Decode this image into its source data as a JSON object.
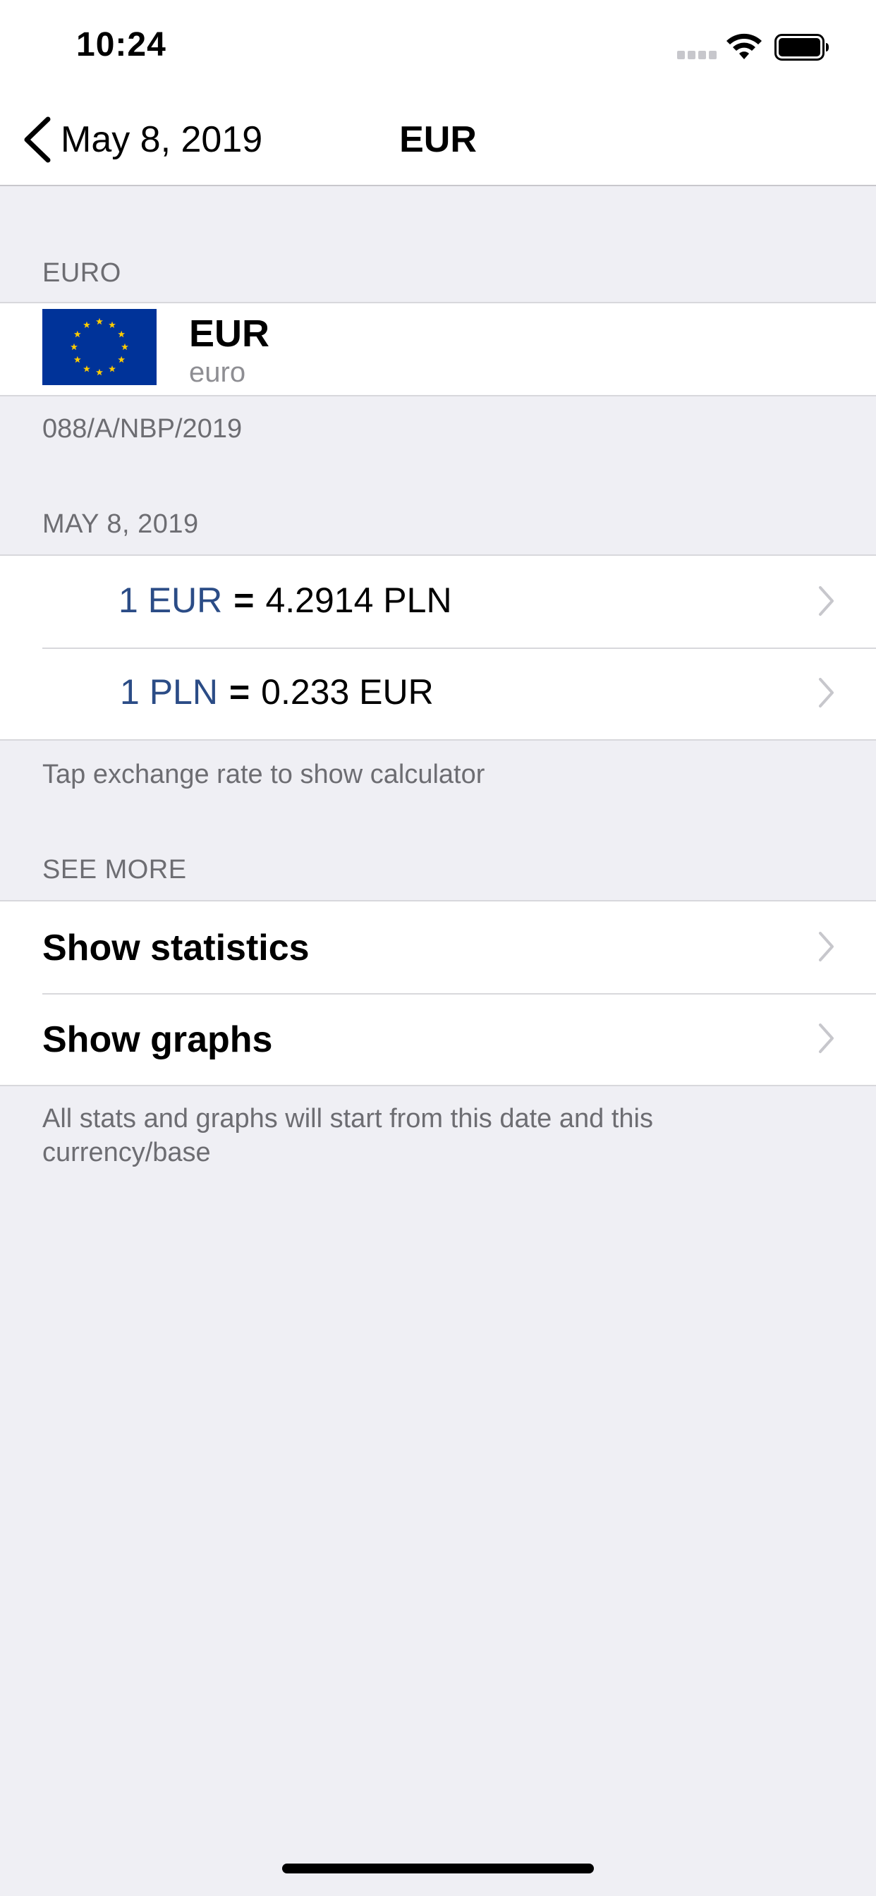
{
  "status_bar": {
    "time": "10:24"
  },
  "nav": {
    "back_label": "May 8, 2019",
    "title": "EUR"
  },
  "currency_section": {
    "header": "EURO",
    "code": "EUR",
    "name": "euro",
    "table_id": "088/A/NBP/2019"
  },
  "rates_section": {
    "header": "MAY 8, 2019",
    "rows": [
      {
        "left": "1 EUR",
        "eq": "=",
        "right": "4.2914 PLN"
      },
      {
        "left": "1 PLN",
        "eq": "=",
        "right": "0.233 EUR"
      }
    ],
    "footer": "Tap exchange rate to show calculator"
  },
  "more_section": {
    "header": "SEE MORE",
    "items": [
      {
        "label": "Show statistics"
      },
      {
        "label": "Show graphs"
      }
    ],
    "footer_line1": "All stats and graphs will start from this date and this",
    "footer_line2": "currency/base"
  },
  "colors": {
    "background": "#EFEFF4",
    "rate_accent": "#2B4C86",
    "eu_flag_blue": "#003399",
    "eu_flag_star": "#FFCC00",
    "chevron": "#C7C7CC"
  },
  "icons": [
    "back-chevron-icon",
    "chevron-right-icon",
    "wifi-icon",
    "battery-icon",
    "eu-flag-icon"
  ]
}
